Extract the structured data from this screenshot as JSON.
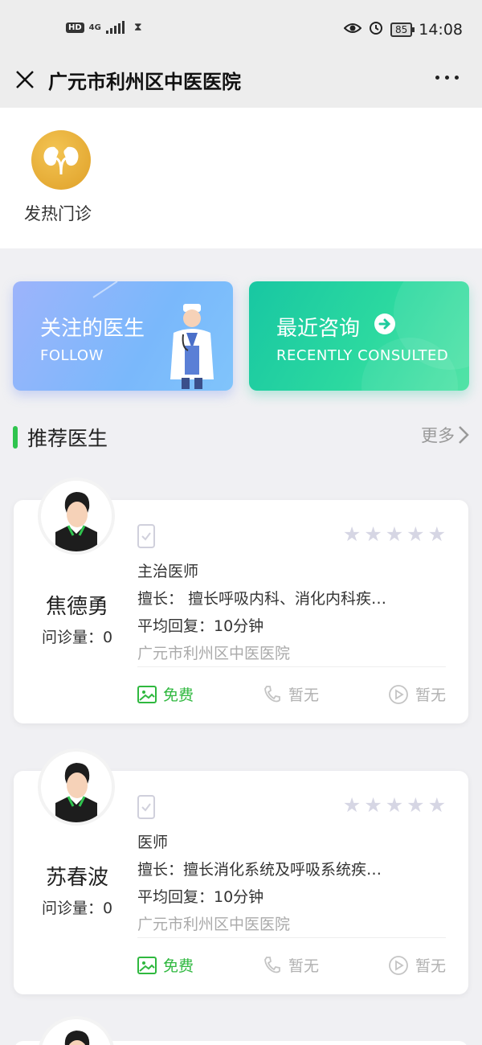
{
  "status_bar": {
    "hd": "HD",
    "network": "4G",
    "battery": "85",
    "time": "14:08"
  },
  "nav": {
    "title": "广元市利州区中医医院"
  },
  "departments": [
    {
      "label": "发热门诊",
      "icon": "kidney-icon"
    }
  ],
  "cards": {
    "follow": {
      "cn": "关注的医生",
      "en": "FOLLOW"
    },
    "recent": {
      "cn": "最近咨询",
      "en": "RECENTLY CONSULTED"
    }
  },
  "recommended": {
    "title": "推荐医生",
    "more": "更多"
  },
  "doctors": [
    {
      "name": "焦德勇",
      "count": "问诊量：0",
      "title": "主治医师",
      "specialty": "擅长：  擅长呼吸内科、消化内科疾…",
      "reply": "平均回复：10分钟",
      "hospital": "广元市利州区中医医院",
      "rating": 0,
      "services": {
        "free": "免费",
        "call": "暂无",
        "video": "暂无"
      }
    },
    {
      "name": "苏春波",
      "count": "问诊量：0",
      "title": "医师",
      "specialty": "擅长：擅长消化系统及呼吸系统疾…",
      "reply": "平均回复：10分钟",
      "hospital": "广元市利州区中医医院",
      "rating": 0,
      "services": {
        "free": "免费",
        "call": "暂无",
        "video": "暂无"
      }
    }
  ],
  "colors": {
    "accent_green": "#2fc44e",
    "free_green": "#2fb83f",
    "star_gray": "#d6d6e4"
  }
}
